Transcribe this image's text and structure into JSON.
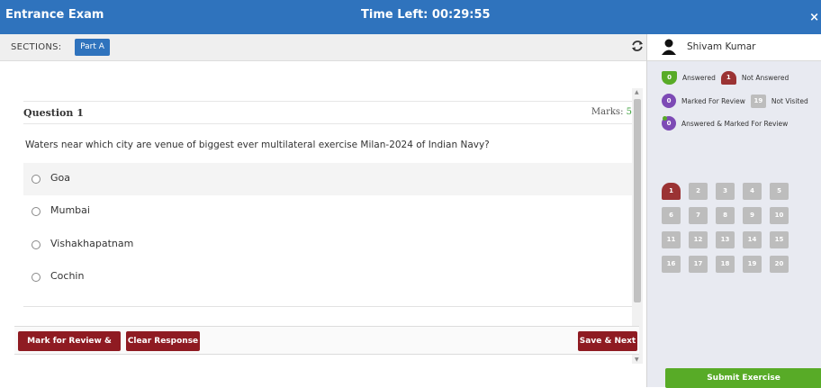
{
  "header": {
    "app_title": "Entrance Exam",
    "timer": "Time Left: 00:29:55",
    "close": "×"
  },
  "sections": {
    "label": "SECTIONS:",
    "active_section": "Part A"
  },
  "question": {
    "number": "Question 1",
    "marks_label": "Marks:",
    "marks_value": "5",
    "text": "Waters near which city are venue of biggest ever multilateral exercise Milan-2024 of Indian Navy?",
    "options": [
      "Goa",
      "Mumbai",
      "Vishakhapatnam",
      "Cochin"
    ],
    "highlighted_option": 0
  },
  "actions": {
    "mark_review": "Mark for Review & Next",
    "clear": "Clear Response",
    "save_next": "Save & Next"
  },
  "user": {
    "name": "Shivam Kumar"
  },
  "legend": {
    "answered": {
      "count": "0",
      "label": "Answered"
    },
    "not_answered": {
      "count": "1",
      "label": "Not Answered"
    },
    "marked_review": {
      "count": "0",
      "label": "Marked For Review"
    },
    "not_visited": {
      "count": "19",
      "label": "Not Visited"
    },
    "answered_marked": {
      "count": "0",
      "label": "Answered & Marked For Review"
    }
  },
  "palette": [
    "1",
    "2",
    "3",
    "4",
    "5",
    "6",
    "7",
    "8",
    "9",
    "10",
    "11",
    "12",
    "13",
    "14",
    "15",
    "16",
    "17",
    "18",
    "19",
    "20"
  ],
  "current_question": "1",
  "submit_label": "Submit Exercise",
  "colors": {
    "brand": "#2f73bd",
    "action": "#8f1b22",
    "answered": "#58ab27",
    "not_answered": "#9b3334",
    "review": "#7d4ab5",
    "not_visited": "#bdbdbd"
  }
}
